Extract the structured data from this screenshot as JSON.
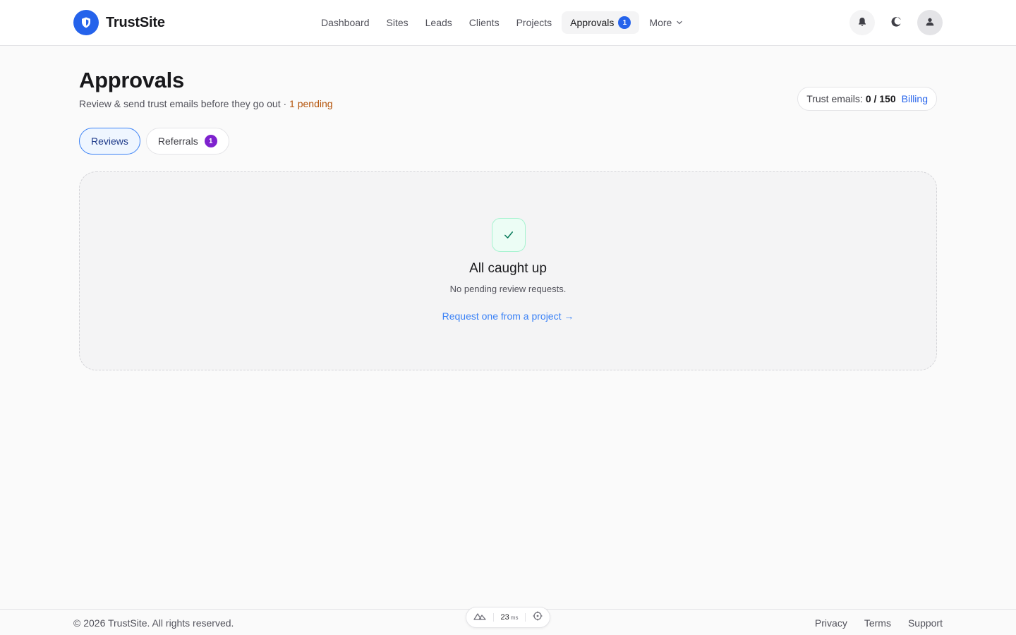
{
  "brand": {
    "name": "TrustSite",
    "logo_icon": "shield-icon",
    "accent": "#2563eb"
  },
  "nav": {
    "items": [
      {
        "label": "Dashboard"
      },
      {
        "label": "Sites"
      },
      {
        "label": "Leads"
      },
      {
        "label": "Clients"
      },
      {
        "label": "Projects"
      },
      {
        "label": "Approvals",
        "badge": "1",
        "active": true
      },
      {
        "label": "More"
      }
    ]
  },
  "header_actions": {
    "notifications_icon": "bell-icon",
    "theme_icon": "moon-icon",
    "avatar_icon": "user-icon"
  },
  "page": {
    "title": "Approvals",
    "subtitle": "Review & send trust emails before they go out",
    "separator": " · ",
    "pending": "1 pending",
    "pending_color": "#b45309"
  },
  "quota": {
    "label": "Trust emails:",
    "count": "0 / 150",
    "billing_label": "Billing"
  },
  "tabs": [
    {
      "label": "Reviews",
      "active": true
    },
    {
      "label": "Referrals",
      "badge": "1",
      "badge_color": "#7e22ce"
    }
  ],
  "empty_state": {
    "icon": "check-icon",
    "title": "All caught up",
    "description": "No pending review requests.",
    "link": "Request one from a project →"
  },
  "footer": {
    "copyright": "© 2026 TrustSite. All rights reserved.",
    "links": [
      "Privacy",
      "Terms",
      "Support"
    ]
  },
  "devbar": {
    "logo_icon": "nuxt-logo-icon",
    "time_value": "23",
    "time_unit": "ms",
    "inspect_icon": "crosshair-icon"
  }
}
